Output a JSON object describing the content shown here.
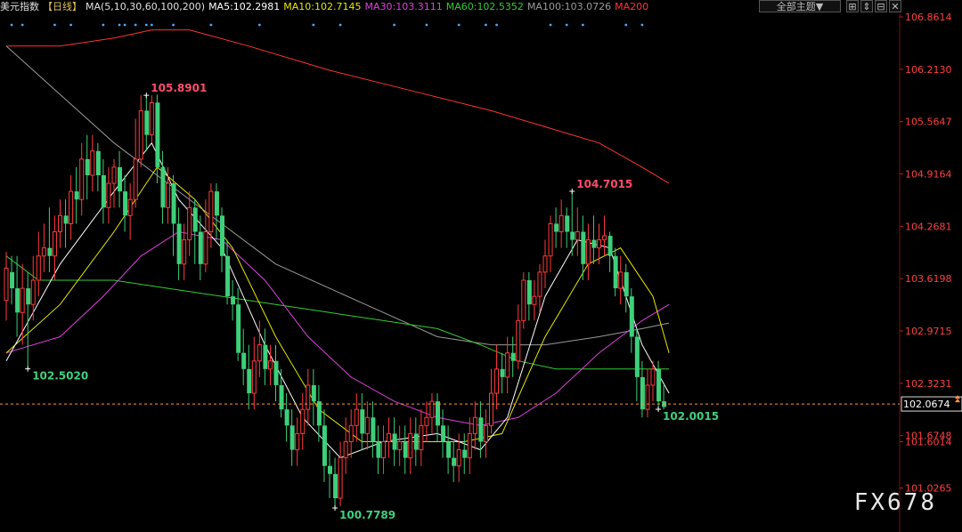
{
  "header": {
    "symbol": "美元指数",
    "period": "【日线】",
    "ma_label": "MA(5,10,30,60,100,200)",
    "ma5": "MA5:102.2981",
    "ma10": "MA10:102.7145",
    "ma30": "MA30:103.3111",
    "ma60": "MA60:102.5352",
    "ma100": "MA100:103.0726",
    "ma200": "MA200"
  },
  "controls": {
    "theme_select": "全部主题▼",
    "btn1": "⊞",
    "btn2": "⇕",
    "btn3": "⊟",
    "btn4": "✕"
  },
  "watermark": "FX678",
  "colors": {
    "up": "#ff3b3b",
    "down": "#3ecf7a",
    "ma5": "#ffffff",
    "ma10": "#e6e600",
    "ma30": "#e040e0",
    "ma60": "#33cc33",
    "ma100": "#9a9a9a",
    "ma200": "#ff3333",
    "axis_text": "#ff4040",
    "current_line": "#ff9933"
  },
  "chart_data": {
    "type": "candlestick",
    "title": "美元指数 日线",
    "ylim": [
      100.7789,
      106.8614
    ],
    "y_ticks": [
      "106.8614",
      "106.2130",
      "105.5647",
      "104.9164",
      "104.2681",
      "103.6198",
      "102.9715",
      "102.3231",
      "101.6748",
      "101.6014",
      "101.0265"
    ],
    "current_price": "102.0674",
    "annotations": [
      {
        "label": "105.8901",
        "value": 105.8901,
        "bar": 26,
        "pos": "high"
      },
      {
        "label": "102.5020",
        "value": 102.502,
        "bar": 4,
        "pos": "low"
      },
      {
        "label": "100.7789",
        "value": 100.7789,
        "bar": 61,
        "pos": "low"
      },
      {
        "label": "104.7015",
        "value": 104.7015,
        "bar": 105,
        "pos": "high"
      },
      {
        "label": "102.0015",
        "value": 102.0015,
        "bar": 121,
        "pos": "low"
      }
    ],
    "candles": [
      [
        103.35,
        103.75,
        103.95,
        103.1
      ],
      [
        103.7,
        103.5,
        103.9,
        103.3
      ],
      [
        103.5,
        103.2,
        103.9,
        102.9
      ],
      [
        103.2,
        103.5,
        103.8,
        102.8
      ],
      [
        103.5,
        103.3,
        103.7,
        102.5
      ],
      [
        103.3,
        103.6,
        103.9,
        103.1
      ],
      [
        103.6,
        103.9,
        104.2,
        103.4
      ],
      [
        103.9,
        104.0,
        104.3,
        103.7
      ],
      [
        104.0,
        103.9,
        104.5,
        103.7
      ],
      [
        103.9,
        104.2,
        104.4,
        103.6
      ],
      [
        104.2,
        104.4,
        104.6,
        104.0
      ],
      [
        104.4,
        104.3,
        104.6,
        104.0
      ],
      [
        104.3,
        104.7,
        104.9,
        104.1
      ],
      [
        104.7,
        104.6,
        105.0,
        104.3
      ],
      [
        104.6,
        105.1,
        105.3,
        104.4
      ],
      [
        105.1,
        104.9,
        105.4,
        104.6
      ],
      [
        104.9,
        105.2,
        105.4,
        104.7
      ],
      [
        105.2,
        104.9,
        105.3,
        104.7
      ],
      [
        104.9,
        104.5,
        105.1,
        104.3
      ],
      [
        104.5,
        104.8,
        105.0,
        104.3
      ],
      [
        104.8,
        105.0,
        105.1,
        104.5
      ],
      [
        105.0,
        104.7,
        105.2,
        104.5
      ],
      [
        104.7,
        104.4,
        104.9,
        104.2
      ],
      [
        104.4,
        104.6,
        104.8,
        104.1
      ],
      [
        104.6,
        105.1,
        105.6,
        104.5
      ],
      [
        105.1,
        105.7,
        105.89,
        105.0
      ],
      [
        105.7,
        105.4,
        105.89,
        105.2
      ],
      [
        105.4,
        105.8,
        105.89,
        105.3
      ],
      [
        105.8,
        105.0,
        105.9,
        104.8
      ],
      [
        105.0,
        104.5,
        105.2,
        104.3
      ],
      [
        104.5,
        104.8,
        105.0,
        104.3
      ],
      [
        104.8,
        104.3,
        104.9,
        103.9
      ],
      [
        104.3,
        103.8,
        104.5,
        103.6
      ],
      [
        103.8,
        104.1,
        104.3,
        103.6
      ],
      [
        104.1,
        104.5,
        104.7,
        103.9
      ],
      [
        104.5,
        104.2,
        104.6,
        103.8
      ],
      [
        104.2,
        103.8,
        104.4,
        103.6
      ],
      [
        103.8,
        104.2,
        104.6,
        103.7
      ],
      [
        104.2,
        104.7,
        104.8,
        104.0
      ],
      [
        104.7,
        104.4,
        104.8,
        104.1
      ],
      [
        104.4,
        103.9,
        104.5,
        103.7
      ],
      [
        103.9,
        103.4,
        104.1,
        103.3
      ],
      [
        103.4,
        103.3,
        103.6,
        103.1
      ],
      [
        103.3,
        102.7,
        103.5,
        102.6
      ],
      [
        102.7,
        102.5,
        103.0,
        102.3
      ],
      [
        102.5,
        102.2,
        102.8,
        102.0
      ],
      [
        102.2,
        102.6,
        102.9,
        102.0
      ],
      [
        102.6,
        102.8,
        103.1,
        102.4
      ],
      [
        102.8,
        102.5,
        103.0,
        102.3
      ],
      [
        102.5,
        102.6,
        102.8,
        102.3
      ],
      [
        102.6,
        102.3,
        102.8,
        102.1
      ],
      [
        102.3,
        102.0,
        102.5,
        101.9
      ],
      [
        102.0,
        101.8,
        102.2,
        101.6
      ],
      [
        101.8,
        101.5,
        102.0,
        101.3
      ],
      [
        101.5,
        101.7,
        101.9,
        101.3
      ],
      [
        101.7,
        102.0,
        102.2,
        101.5
      ],
      [
        102.0,
        102.3,
        102.5,
        101.8
      ],
      [
        102.3,
        102.1,
        102.5,
        101.8
      ],
      [
        102.1,
        101.8,
        102.3,
        101.6
      ],
      [
        101.8,
        101.3,
        102.0,
        101.1
      ],
      [
        101.3,
        101.2,
        101.5,
        100.9
      ],
      [
        101.2,
        100.9,
        101.4,
        100.78
      ],
      [
        100.9,
        101.4,
        101.6,
        100.8
      ],
      [
        101.4,
        101.6,
        101.9,
        101.2
      ],
      [
        101.6,
        101.8,
        102.0,
        101.4
      ],
      [
        101.8,
        102.0,
        102.2,
        101.6
      ],
      [
        102.0,
        101.7,
        102.2,
        101.5
      ],
      [
        101.7,
        101.9,
        102.1,
        101.5
      ],
      [
        101.9,
        101.6,
        102.1,
        101.4
      ],
      [
        101.6,
        101.4,
        101.8,
        101.2
      ],
      [
        101.4,
        101.6,
        101.8,
        101.2
      ],
      [
        101.6,
        101.7,
        101.9,
        101.4
      ],
      [
        101.7,
        101.5,
        101.9,
        101.3
      ],
      [
        101.5,
        101.6,
        101.8,
        101.3
      ],
      [
        101.6,
        101.4,
        101.8,
        101.2
      ],
      [
        101.4,
        101.7,
        101.9,
        101.2
      ],
      [
        101.7,
        101.5,
        101.9,
        101.3
      ],
      [
        101.5,
        101.8,
        102.0,
        101.3
      ],
      [
        101.8,
        101.9,
        102.1,
        101.6
      ],
      [
        101.9,
        102.1,
        102.2,
        101.7
      ],
      [
        102.1,
        101.8,
        102.2,
        101.6
      ],
      [
        101.8,
        101.6,
        102.0,
        101.4
      ],
      [
        101.6,
        101.4,
        101.8,
        101.2
      ],
      [
        101.4,
        101.3,
        101.6,
        101.1
      ],
      [
        101.3,
        101.5,
        101.7,
        101.1
      ],
      [
        101.5,
        101.4,
        101.7,
        101.2
      ],
      [
        101.4,
        101.7,
        101.9,
        101.2
      ],
      [
        101.7,
        101.9,
        102.1,
        101.5
      ],
      [
        101.9,
        101.6,
        102.1,
        101.4
      ],
      [
        101.6,
        101.8,
        102.0,
        101.4
      ],
      [
        101.8,
        102.2,
        102.5,
        101.7
      ],
      [
        102.2,
        102.5,
        102.8,
        102.0
      ],
      [
        102.5,
        102.4,
        102.7,
        102.2
      ],
      [
        102.4,
        102.7,
        102.9,
        102.2
      ],
      [
        102.7,
        102.6,
        102.9,
        102.4
      ],
      [
        102.6,
        103.1,
        103.3,
        102.5
      ],
      [
        103.1,
        103.6,
        103.7,
        103.0
      ],
      [
        103.6,
        103.3,
        103.7,
        103.1
      ],
      [
        103.3,
        103.4,
        103.6,
        103.1
      ],
      [
        103.4,
        103.7,
        103.8,
        103.2
      ],
      [
        103.7,
        103.9,
        104.1,
        103.5
      ],
      [
        103.9,
        104.3,
        104.4,
        103.7
      ],
      [
        104.3,
        104.2,
        104.5,
        104.0
      ],
      [
        104.2,
        104.4,
        104.6,
        104.0
      ],
      [
        104.4,
        104.2,
        104.5,
        104.0
      ],
      [
        104.2,
        104.1,
        104.7,
        103.9
      ],
      [
        104.1,
        104.2,
        104.5,
        103.9
      ],
      [
        104.2,
        103.8,
        104.4,
        103.6
      ],
      [
        103.8,
        104.1,
        104.3,
        103.6
      ],
      [
        104.1,
        104.0,
        104.4,
        103.8
      ],
      [
        104.0,
        104.1,
        104.3,
        103.8
      ],
      [
        104.1,
        104.15,
        104.4,
        103.9
      ],
      [
        104.15,
        103.9,
        104.2,
        103.7
      ],
      [
        103.9,
        103.5,
        104.0,
        103.4
      ],
      [
        103.5,
        103.7,
        103.9,
        103.3
      ],
      [
        103.7,
        103.4,
        103.8,
        103.2
      ],
      [
        103.4,
        102.9,
        103.5,
        102.7
      ],
      [
        102.9,
        102.4,
        103.0,
        102.1
      ],
      [
        102.4,
        102.0,
        102.6,
        101.9
      ],
      [
        102.0,
        102.3,
        102.5,
        101.9
      ],
      [
        102.3,
        102.5,
        102.6,
        102.1
      ],
      [
        102.5,
        102.1,
        102.6,
        102.0
      ],
      [
        102.1,
        102.03,
        102.3,
        102.0
      ]
    ],
    "ma_lines": {
      "ma5": [
        [
          0,
          102.6
        ],
        [
          10,
          103.8
        ],
        [
          20,
          104.7
        ],
        [
          27,
          105.3
        ],
        [
          32,
          104.6
        ],
        [
          40,
          104.0
        ],
        [
          48,
          102.8
        ],
        [
          55,
          101.9
        ],
        [
          62,
          101.4
        ],
        [
          70,
          101.6
        ],
        [
          80,
          101.7
        ],
        [
          88,
          101.5
        ],
        [
          93,
          101.9
        ],
        [
          100,
          103.4
        ],
        [
          106,
          104.1
        ],
        [
          112,
          104.0
        ],
        [
          118,
          102.8
        ],
        [
          123,
          102.2
        ]
      ],
      "ma10": [
        [
          0,
          102.7
        ],
        [
          10,
          103.3
        ],
        [
          20,
          104.2
        ],
        [
          28,
          105.0
        ],
        [
          35,
          104.6
        ],
        [
          42,
          104.0
        ],
        [
          50,
          102.9
        ],
        [
          58,
          102.0
        ],
        [
          66,
          101.6
        ],
        [
          75,
          101.6
        ],
        [
          85,
          101.6
        ],
        [
          92,
          101.7
        ],
        [
          100,
          102.9
        ],
        [
          108,
          103.8
        ],
        [
          114,
          104.0
        ],
        [
          120,
          103.4
        ],
        [
          123,
          102.7
        ]
      ],
      "ma30": [
        [
          0,
          102.7
        ],
        [
          10,
          102.9
        ],
        [
          18,
          103.4
        ],
        [
          25,
          103.9
        ],
        [
          32,
          104.2
        ],
        [
          40,
          104.1
        ],
        [
          48,
          103.6
        ],
        [
          56,
          102.9
        ],
        [
          64,
          102.4
        ],
        [
          72,
          102.1
        ],
        [
          80,
          101.9
        ],
        [
          88,
          101.8
        ],
        [
          95,
          101.9
        ],
        [
          102,
          102.2
        ],
        [
          110,
          102.7
        ],
        [
          118,
          103.1
        ],
        [
          123,
          103.3
        ]
      ],
      "ma60": [
        [
          0,
          103.9
        ],
        [
          6,
          103.6
        ],
        [
          12,
          103.6
        ],
        [
          20,
          103.6
        ],
        [
          30,
          103.5
        ],
        [
          40,
          103.4
        ],
        [
          50,
          103.3
        ],
        [
          60,
          103.2
        ],
        [
          70,
          103.1
        ],
        [
          80,
          103.0
        ],
        [
          88,
          102.8
        ],
        [
          95,
          102.6
        ],
        [
          102,
          102.5
        ],
        [
          110,
          102.5
        ],
        [
          118,
          102.5
        ],
        [
          123,
          102.5
        ]
      ],
      "ma100": [
        [
          0,
          106.5
        ],
        [
          10,
          105.9
        ],
        [
          20,
          105.3
        ],
        [
          30,
          104.8
        ],
        [
          40,
          104.3
        ],
        [
          50,
          103.8
        ],
        [
          60,
          103.5
        ],
        [
          70,
          103.2
        ],
        [
          80,
          102.9
        ],
        [
          90,
          102.8
        ],
        [
          100,
          102.8
        ],
        [
          110,
          102.9
        ],
        [
          118,
          103.0
        ],
        [
          123,
          103.07
        ]
      ],
      "ma200": [
        [
          0,
          106.5
        ],
        [
          10,
          106.5
        ],
        [
          20,
          106.6
        ],
        [
          27,
          106.7
        ],
        [
          34,
          106.7
        ],
        [
          45,
          106.5
        ],
        [
          60,
          106.2
        ],
        [
          75,
          105.95
        ],
        [
          90,
          105.7
        ],
        [
          100,
          105.5
        ],
        [
          110,
          105.3
        ],
        [
          118,
          105.0
        ],
        [
          123,
          104.8
        ]
      ]
    },
    "top_markers": [
      1,
      3,
      9,
      12,
      18,
      21,
      22,
      24,
      26,
      27,
      31,
      38,
      47,
      57,
      62,
      72,
      78,
      84,
      89,
      91,
      101,
      104,
      107,
      115,
      118
    ]
  }
}
